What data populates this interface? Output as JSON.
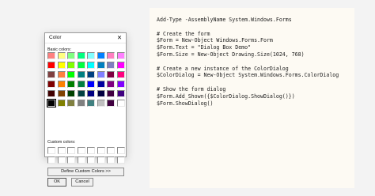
{
  "dialog": {
    "title": "Color",
    "close_glyph": "✕",
    "basic_colors_label": "Basic colors:",
    "custom_colors_label": "Custom colors:",
    "basic_colors": [
      "#ff8080",
      "#ffff80",
      "#80ff80",
      "#00ff80",
      "#80ffff",
      "#0080ff",
      "#ff80c0",
      "#ff80ff",
      "#ff0000",
      "#ffff00",
      "#80ff00",
      "#00ff40",
      "#00ffff",
      "#0080c0",
      "#8080c0",
      "#ff00ff",
      "#804040",
      "#ff8040",
      "#00ff00",
      "#008080",
      "#004080",
      "#8080ff",
      "#800040",
      "#ff0080",
      "#800000",
      "#ff8000",
      "#008000",
      "#008040",
      "#0000ff",
      "#0000a0",
      "#800080",
      "#8000ff",
      "#400000",
      "#804000",
      "#004000",
      "#004040",
      "#000080",
      "#000040",
      "#400040",
      "#400080",
      "#000000",
      "#808000",
      "#808040",
      "#808080",
      "#408080",
      "#c0c0c0",
      "#400040",
      "#ffffff"
    ],
    "selected_color_index": 40,
    "custom_colors": [
      "#ffffff",
      "#ffffff",
      "#ffffff",
      "#ffffff",
      "#ffffff",
      "#ffffff",
      "#ffffff",
      "#ffffff",
      "#ffffff",
      "#ffffff",
      "#ffffff",
      "#ffffff",
      "#ffffff",
      "#ffffff",
      "#ffffff",
      "#ffffff"
    ],
    "define_custom_label": "Define Custom Colors >>",
    "ok_label": "OK",
    "cancel_label": "Cancel"
  },
  "code": {
    "lines": [
      "Add-Type -AssemblyName System.Windows.Forms",
      "",
      "# Create the form",
      "$Form = New-Object Windows.Forms.Form",
      "$Form.Text = \"Dialog Box Demo\"",
      "$Form.Size = New-Object Drawing.Size(1024, 768)",
      "",
      "# Create a new instance of the ColorDialog",
      "$ColorDialog = New-Object System.Windows.Forms.ColorDialog",
      "",
      "# Show the form dialog",
      "$Form.Add_Shown({$ColorDialog.ShowDialog()})",
      "$Form.ShowDialog()"
    ]
  }
}
